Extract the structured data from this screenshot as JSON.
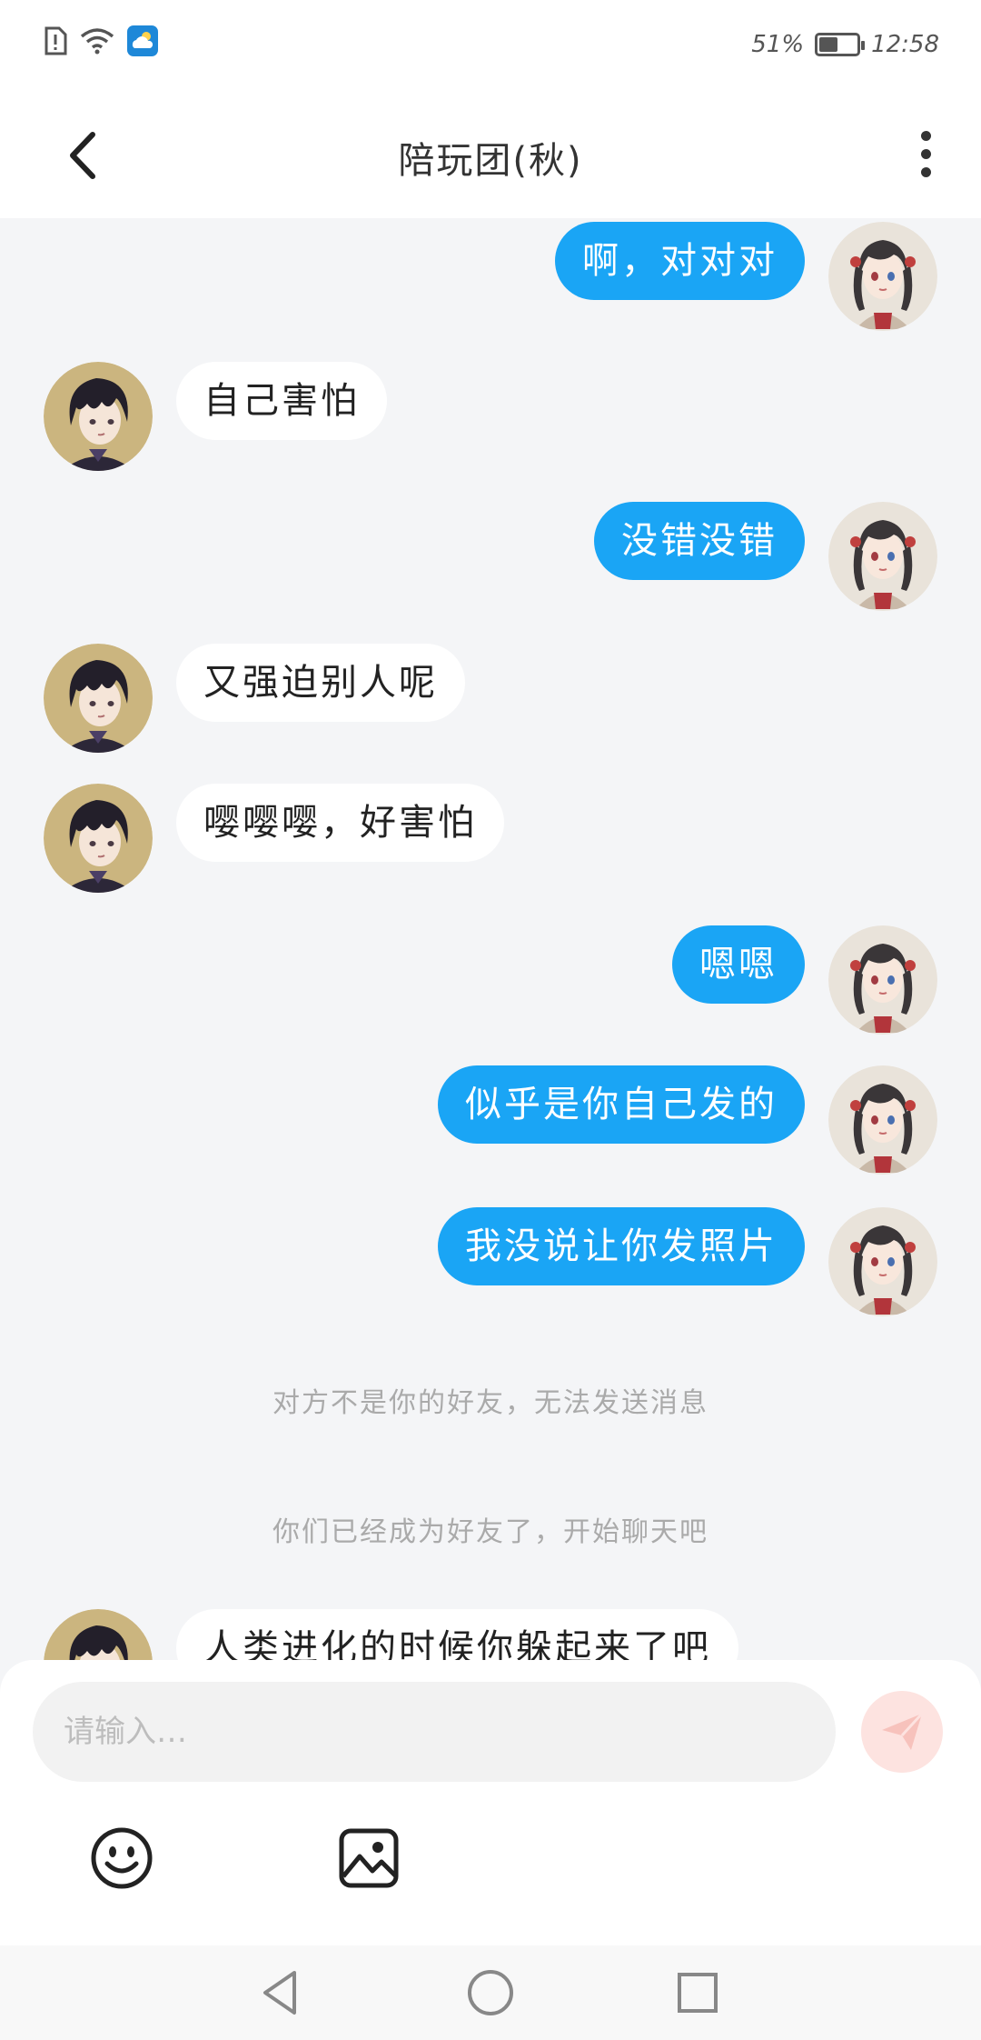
{
  "status_bar": {
    "battery_text": "51%",
    "battery_level": 0.51,
    "time": "12:58",
    "icons": [
      "sim-alert-icon",
      "wifi-icon",
      "weather-cloud-icon"
    ]
  },
  "header": {
    "title": "陪玩团(秋)",
    "back_icon": "back-arrow-icon",
    "more_icon": "more-vertical-icon"
  },
  "messages": [
    {
      "side": "me",
      "text": "啊，对对对"
    },
    {
      "side": "other",
      "text": "自己害怕"
    },
    {
      "side": "me",
      "text": "没错没错"
    },
    {
      "side": "other",
      "text": "又强迫别人呢"
    },
    {
      "side": "other",
      "text": "嘤嘤嘤，好害怕"
    },
    {
      "side": "me",
      "text": "嗯嗯"
    },
    {
      "side": "me",
      "text": "似乎是你自己发的"
    },
    {
      "side": "me",
      "text": "我没说让你发照片"
    },
    {
      "side": "other",
      "text": "人类进化的时候你躲起来了吧"
    }
  ],
  "notices": [
    "对方不是你的好友，无法发送消息",
    "你们已经成为好友了，开始聊天吧"
  ],
  "input": {
    "placeholder": "请输入…",
    "value": ""
  },
  "toolbar": {
    "emoji_icon": "emoji-icon",
    "image_icon": "image-icon",
    "send_icon": "send-icon"
  },
  "colors": {
    "accent_blue": "#1aa5f5",
    "background": "#f4f5f7",
    "send_button": "#fde3e0"
  }
}
